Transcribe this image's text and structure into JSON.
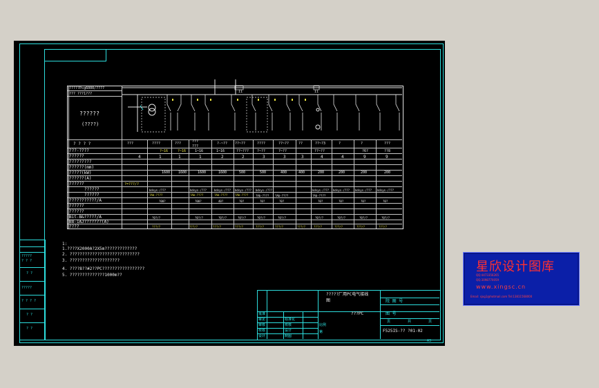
{
  "header_box": {
    "line1": "?????Pcg6000/????",
    "line2": "??? ???1???"
  },
  "left_panel": {
    "title": "??????",
    "subtitle": "(????)",
    "q_row": "?   ?   ?   ?",
    "row_labels": [
      "???-????",
      "??????",
      "?????????",
      "??????(mm)",
      "?????(kW)",
      "??????(A)",
      "??????",
      "??????",
      "??????",
      "???????????/A",
      "??????",
      "??????",
      "Bit-B&?????/A",
      "B8-1AJ???????(A)",
      "????"
    ]
  },
  "circuits": {
    "names": [
      "???",
      "????",
      "???",
      "???\n???",
      "?-~??",
      "??~??",
      "????",
      "??~??",
      "??",
      "??~?3",
      "?",
      "?",
      "???",
      "??"
    ],
    "numbers": [
      "?~16",
      "?~16",
      "?~16",
      "1~16",
      "1~16",
      "??~???",
      "?~??",
      "?~??",
      "??~?9",
      "??~??",
      "?",
      "?",
      "?6?",
      "??8"
    ],
    "row3": [
      "4",
      "1",
      "1",
      "1",
      "2",
      "2",
      "3",
      "3",
      "3",
      "4",
      "4",
      "9",
      "9",
      "6"
    ],
    "row_mm": [
      "1600",
      "1600",
      "1600",
      "1600",
      "500",
      "500",
      "400",
      "400",
      "200",
      "200",
      "200",
      "200"
    ],
    "row_p1": [
      "?=???/?",
      "bdsys-/???",
      "bdsys-/???",
      "bdsys-/???",
      "bdsys-/???",
      "bdsys-/???",
      "bdsys-/???",
      "bdsys-/???",
      "bdsys-/???",
      "bdsys-/???"
    ],
    "row_p2": [
      "?Ab-????",
      "?Ab-????",
      "?Ab-????",
      "?Ab-????",
      "?Ab-????",
      "?Ab-????",
      "?Ab-????"
    ],
    "row_p3": [
      "?00?",
      "?00?",
      "40?",
      "?0?",
      "?0?",
      "?0?",
      "?0?",
      "?0?",
      "?0?",
      "?0?"
    ],
    "row_bottom": [
      "?0?/?",
      "?0?/?",
      "?0?/?",
      "?0?/?",
      "?0?/?",
      "?0?/?",
      "?0?/?",
      "?0?/?",
      "?0?/?",
      "?0?/?"
    ],
    "row_end": [
      "???/?",
      "???/?",
      "???/?",
      "???/?",
      "???/?",
      "???/?",
      "???/?",
      "???/?",
      "???/?",
      "???/?",
      "???/?",
      "???/?",
      "???/?",
      "???/?"
    ],
    "bus_label_left": "I1",
    "bus_label_right": "I1"
  },
  "notes": {
    "head": "1:",
    "lines": [
      "1.????X2000A?2X5m?????????????",
      "2. ????????????????????????????",
      "3. ????????????????????",
      "4. ????8??#2??PC?????????????????",
      "5. ??????????????1000m??"
    ]
  },
  "left_strip": {
    "cells": [
      "?????\n? ? ?",
      "? ?",
      "?????",
      "? ? ? ?",
      "? ?",
      "? ?"
    ]
  },
  "title_block": {
    "drawing_title": "?????厂用PC电气接线",
    "drawing_subtitle": "图",
    "center_note": "???PC",
    "right_head": "院 图 号",
    "right_top": "图  号",
    "drawing_no": "F525IS-?? ?01-02",
    "sig_rows": [
      "批准",
      "审定",
      "审核",
      "校核",
      "设计"
    ],
    "sig_rows_right": [
      "标准化",
      "校核",
      "设计",
      "制图"
    ],
    "misc": [
      "比例",
      "第",
      "页",
      "共",
      "页"
    ],
    "page_corner": "A3"
  },
  "stamp": {
    "title": "星欣设计图库",
    "qq1": "QQ:4473356265",
    "qq2": "QQ:3098770059",
    "site": "www.xingsc.cn",
    "contact": "Email: sjxg1@hotmail.com  Tel:13811568000"
  },
  "colors": {
    "background": "#d4d0c8",
    "canvas": "#000000",
    "frame": "#2de0e0",
    "line": "#e8e8e8",
    "label": "#e8e040",
    "stamp_bg": "#0b1fa8",
    "stamp_text": "#ff3030"
  }
}
